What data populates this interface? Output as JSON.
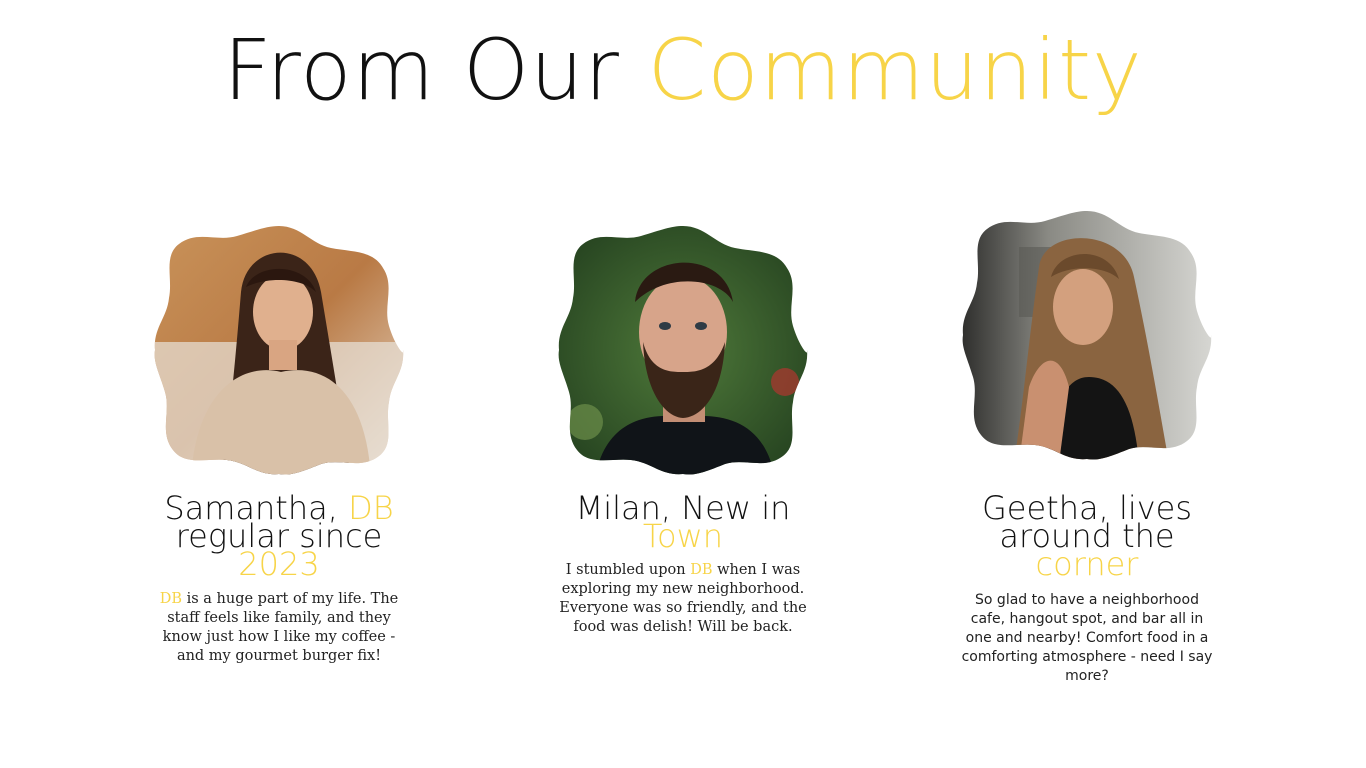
{
  "section": {
    "title_main": "From Our ",
    "title_accent": "Community"
  },
  "colors": {
    "accent": "#f7d448",
    "text": "#111111"
  },
  "testimonials": [
    {
      "name_part1": "Samantha, ",
      "name_accent1": "DB",
      "name_part2": "regular since",
      "name_accent2": "2023",
      "quote_accent": "DB",
      "quote_text": " is a huge part of my life. The staff feels like family, and they know just how I like my coffee - and my gourmet burger fix!"
    },
    {
      "name_part1": "Milan, New in",
      "name_accent1": "Town",
      "quote_prefix": "I stumbled upon ",
      "quote_accent": "DB",
      "quote_text": " when I was exploring my new neighborhood. Everyone was so friendly, and the food was delish! Will be back."
    },
    {
      "name_part1": "Geetha, lives",
      "name_part2": "around the",
      "name_accent1": "corner",
      "quote_text": "So glad to have a neighborhood cafe, hangout spot, and bar all in one and nearby! Comfort food in a comforting atmosphere - need I say more?"
    }
  ]
}
